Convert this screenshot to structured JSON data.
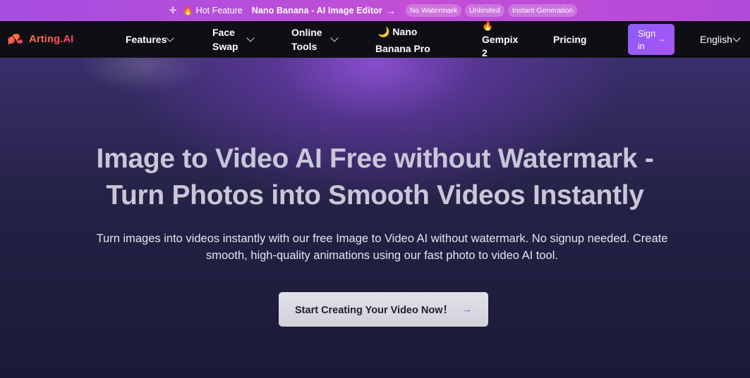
{
  "promo": {
    "sparkle_icon": "sparkle-icon",
    "hot_label": "🔥 Hot Feature",
    "link_text": "Nano Banana - AI Image Editor",
    "arrow": "→",
    "pills": [
      "No Watermark",
      "Unlimited",
      "Instant Generation"
    ]
  },
  "nav": {
    "logo_text": "Arting.AI",
    "items": {
      "features": "Features",
      "face_swap_1": "Face",
      "face_swap_2": "Swap",
      "online_tools_1": "Online",
      "online_tools_2": "Tools",
      "nano_1": "🌙  Nano",
      "nano_2": "Banana Pro",
      "gempix_icon": "🔥",
      "gempix_1": "Gempix",
      "gempix_2": "2",
      "pricing": "Pricing"
    },
    "signin_1": "Sign",
    "signin_2": "in",
    "signin_arrow": "→",
    "language": "English"
  },
  "hero": {
    "title_line1": "Image to Video AI Free without Watermark -",
    "title_line2": "Turn Photos into Smooth Videos Instantly",
    "subtitle_line1": "Turn images into videos instantly with our free Image to Video AI without watermark. No signup needed. Create",
    "subtitle_line2": "smooth, high-quality animations using our fast photo to video AI tool.",
    "cta_label": "Start Creating Your Video Now！",
    "cta_arrow": "→"
  },
  "colors": {
    "promo_bg": "#b24ad9",
    "nav_bg": "#0e0e14",
    "accent": "#8b5cf6",
    "logo": "#ff5a5a"
  }
}
